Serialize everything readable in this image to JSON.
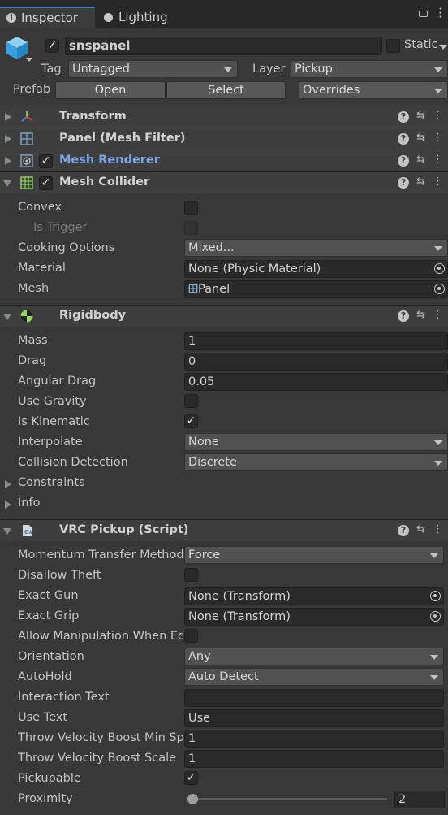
{
  "tabs": [
    {
      "label": "Inspector",
      "icon": "info-icon"
    },
    {
      "label": "Lighting",
      "icon": "light-bulb-icon"
    }
  ],
  "object": {
    "name": "snspanel",
    "active": true,
    "static_label": "Static",
    "tag_label": "Tag",
    "tag_value": "Untagged",
    "layer_label": "Layer",
    "layer_value": "Pickup",
    "prefab_label": "Prefab",
    "open_label": "Open",
    "select_label": "Select",
    "overrides_label": "Overrides"
  },
  "components": {
    "transform": {
      "title": "Transform"
    },
    "mesh_filter": {
      "title": "Panel (Mesh Filter)"
    },
    "mesh_renderer": {
      "title": "Mesh Renderer",
      "enabled": true
    },
    "mesh_collider": {
      "title": "Mesh Collider",
      "enabled": true,
      "convex_label": "Convex",
      "is_trigger_label": "Is Trigger",
      "cooking_label": "Cooking Options",
      "cooking_value": "Mixed...",
      "material_label": "Material",
      "material_value": "None (Physic Material)",
      "mesh_label": "Mesh",
      "mesh_value": "Panel"
    },
    "rigidbody": {
      "title": "Rigidbody",
      "mass_label": "Mass",
      "mass_value": "1",
      "drag_label": "Drag",
      "drag_value": "0",
      "angular_drag_label": "Angular Drag",
      "angular_drag_value": "0.05",
      "use_gravity_label": "Use Gravity",
      "use_gravity": false,
      "is_kinematic_label": "Is Kinematic",
      "is_kinematic": true,
      "interpolate_label": "Interpolate",
      "interpolate_value": "None",
      "collision_label": "Collision Detection",
      "collision_value": "Discrete",
      "constraints_label": "Constraints",
      "info_label": "Info"
    },
    "vrc_pickup": {
      "title": "VRC Pickup (Script)",
      "momentum_label": "Momentum Transfer Method",
      "momentum_value": "Force",
      "disallow_theft_label": "Disallow Theft",
      "disallow_theft": false,
      "exact_gun_label": "Exact Gun",
      "exact_gun_value": "None (Transform)",
      "exact_grip_label": "Exact Grip",
      "exact_grip_value": "None (Transform)",
      "allow_manip_label": "Allow Manipulation When Equipped",
      "allow_manip": false,
      "orientation_label": "Orientation",
      "orientation_value": "Any",
      "autohold_label": "AutoHold",
      "autohold_value": "Auto Detect",
      "interaction_text_label": "Interaction Text",
      "interaction_text_value": "",
      "use_text_label": "Use Text",
      "use_text_value": "Use",
      "throw_min_label": "Throw Velocity Boost Min Speed",
      "throw_min_value": "1",
      "throw_scale_label": "Throw Velocity Boost Scale",
      "throw_scale_value": "1",
      "pickupable_label": "Pickupable",
      "pickupable": true,
      "proximity_label": "Proximity",
      "proximity_value": "2",
      "proximity_fraction": 0.0
    }
  },
  "colors": {
    "accent": "#3a79bb",
    "link_title": "#7ea5e4",
    "background": "#383838"
  }
}
